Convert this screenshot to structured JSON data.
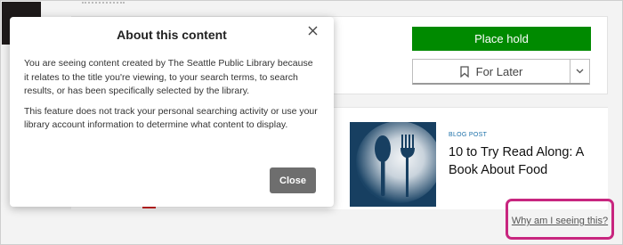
{
  "modal": {
    "title": "About this content",
    "paragraphs": [
      "You are seeing content created by The Seattle Public Library because it relates to the title you're viewing, to your search terms, to search results, or has been specifically selected by the library.",
      "This feature does not track your personal searching activity or use your library account information to determine what content to display."
    ],
    "close_label": "Close",
    "close_icon": "close-icon"
  },
  "actions": {
    "place_hold_label": "Place hold",
    "for_later_label": "For Later",
    "for_later_icon": "bookmark-icon",
    "dropdown_icon": "chevron-down-icon"
  },
  "blog": {
    "tag": "BLOG POST",
    "title": "10 to Try Read Along: A Book About Food",
    "image": "spoon-fork-salt-image"
  },
  "why_link": {
    "label": "Why am I seeing this?"
  },
  "colors": {
    "place_hold_bg": "#008a00",
    "highlight_border": "#c8267f",
    "blog_tag": "#1a6fa8",
    "close_button_bg": "#6e6e6e"
  }
}
